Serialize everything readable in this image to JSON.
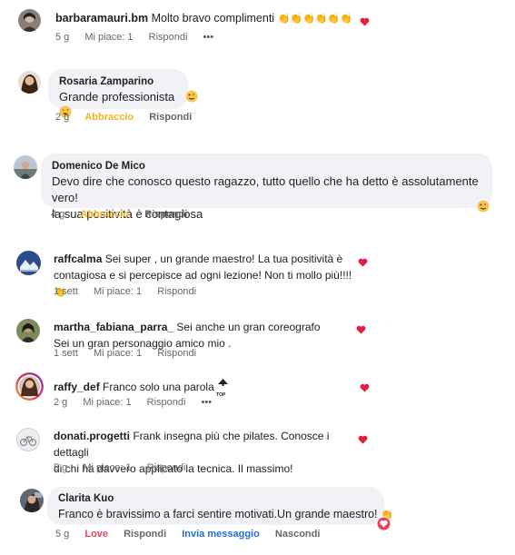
{
  "comments": [
    {
      "user": "barbaramauri.bm",
      "text": "Molto bravo complimenti",
      "emoji": "👏👏👏👏👏👏",
      "time": "5 g",
      "likes": "Mi piace: 1",
      "reply": "Rispondi",
      "more": "•••"
    },
    {
      "user": "Rosaria Zamparino",
      "text": "Grande professionista",
      "time": "2 g",
      "reaction": "Abbraccio",
      "reply": "Rispondi"
    },
    {
      "user": "Domenico De Mico",
      "text_line1": "Devo dire che conosco questo ragazzo, tutto quello che ha detto è assolutamente vero!",
      "text_line2": "la sua positività è contagiosa",
      "time": "4 g",
      "reaction": "Abbraccio",
      "reply": "Rispondi"
    },
    {
      "user": "raffcalma",
      "text_line1": "Sei super , un grande maestro! La tua positività è",
      "text_line2": "contagiosa e si percepisce ad ogni lezione! Non ti mollo più!!!!",
      "time": "1 sett",
      "likes": "Mi piace: 1",
      "reply": "Rispondi"
    },
    {
      "user": "martha_fabiana_parra_",
      "text_line1": "Sei anche un gran coreografo",
      "text_line2": "Sei un gran personaggio amico mio .",
      "time": "1 sett",
      "likes": "Mi piace: 1",
      "reply": "Rispondi"
    },
    {
      "user": "raffy_def",
      "text": "Franco solo una parola",
      "time": "2 g",
      "likes": "Mi piace: 1",
      "reply": "Rispondi",
      "more": "•••",
      "top_badge": "TOP"
    },
    {
      "user": "donati.progetti",
      "text_line1": "Frank insegna più che pilates. Conosce i dettagli",
      "text_line2": "di chi ha davvero applicato la tecnica. Il massimo!",
      "time": "5 g",
      "likes": "Mi piace: 1",
      "reply": "Rispondi"
    },
    {
      "user": "Clarita Kuo",
      "text": "Franco è bravissimo a farci sentire motivati.Un grande maestro!",
      "time": "5 g",
      "reaction": "Love",
      "reply": "Rispondi",
      "message": "Invia messaggio",
      "hide": "Nascondi"
    }
  ],
  "colors": {
    "heart": "#e41e3f",
    "amber": "#f7b125",
    "love": "#f33e58",
    "blue": "#216fdb",
    "bubble": "#f0f2f5",
    "meta": "#65676b"
  }
}
